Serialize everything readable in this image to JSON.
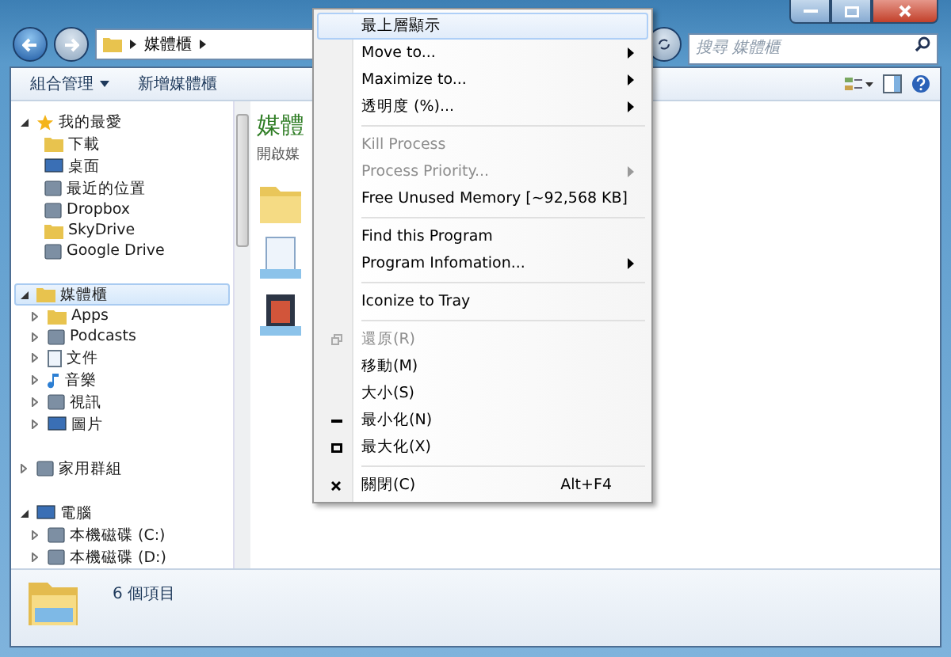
{
  "address_bar": {
    "crumbs": [
      "媒體櫃"
    ]
  },
  "search": {
    "placeholder": "搜尋 媒體櫃"
  },
  "toolbar": {
    "buttons": [
      {
        "label": "組合管理",
        "dropdown": true
      },
      {
        "label": "新增媒體櫃",
        "dropdown": false
      }
    ]
  },
  "sidebar": {
    "groups": [
      {
        "label": "我的最愛",
        "kind": "star",
        "expanded": true,
        "selected": false,
        "children": [
          {
            "label": "下載",
            "kind": "folder"
          },
          {
            "label": "桌面",
            "kind": "screen"
          },
          {
            "label": "最近的位置",
            "kind": "square"
          },
          {
            "label": "Dropbox",
            "kind": "square"
          },
          {
            "label": "SkyDrive",
            "kind": "folder"
          },
          {
            "label": "Google Drive",
            "kind": "square"
          }
        ]
      },
      {
        "label": "媒體櫃",
        "kind": "folder",
        "expanded": true,
        "selected": true,
        "children": [
          {
            "label": "Apps",
            "kind": "folder"
          },
          {
            "label": "Podcasts",
            "kind": "square"
          },
          {
            "label": "文件",
            "kind": "document"
          },
          {
            "label": "音樂",
            "kind": "music"
          },
          {
            "label": "視訊",
            "kind": "square"
          },
          {
            "label": "圖片",
            "kind": "screen"
          }
        ]
      },
      {
        "label": "家用群組",
        "kind": "square",
        "expanded": false,
        "selected": false
      },
      {
        "label": "電腦",
        "kind": "screen",
        "expanded": true,
        "selected": false,
        "children": [
          {
            "label": "本機磁碟 (C:)",
            "kind": "square"
          },
          {
            "label": "本機磁碟 (D:)",
            "kind": "square"
          }
        ]
      }
    ]
  },
  "content": {
    "title": "媒體",
    "subtitle": "開啟媒"
  },
  "status_bar": {
    "text": "6 個項目"
  },
  "context_menu": {
    "items": [
      {
        "kind": "item",
        "label": "最上層顯示",
        "selected": true,
        "disabled": false,
        "submenu": false
      },
      {
        "kind": "item",
        "label": "Move to...",
        "selected": false,
        "disabled": false,
        "submenu": true
      },
      {
        "kind": "item",
        "label": "Maximize to...",
        "selected": false,
        "disabled": false,
        "submenu": true
      },
      {
        "kind": "item",
        "label": "透明度 (%)...",
        "selected": false,
        "disabled": false,
        "submenu": true
      },
      {
        "kind": "separator"
      },
      {
        "kind": "item",
        "label": "Kill Process",
        "selected": false,
        "disabled": true,
        "submenu": false
      },
      {
        "kind": "item",
        "label": "Process Priority...",
        "selected": false,
        "disabled": true,
        "submenu": true
      },
      {
        "kind": "item",
        "label": "Free Unused Memory [~92,568 KB]",
        "selected": false,
        "disabled": false,
        "submenu": false
      },
      {
        "kind": "separator"
      },
      {
        "kind": "item",
        "label": "Find this Program",
        "selected": false,
        "disabled": false,
        "submenu": false
      },
      {
        "kind": "item",
        "label": "Program Infomation...",
        "selected": false,
        "disabled": false,
        "submenu": true
      },
      {
        "kind": "separator"
      },
      {
        "kind": "item",
        "label": "Iconize to Tray",
        "selected": false,
        "disabled": false,
        "submenu": false
      },
      {
        "kind": "separator"
      },
      {
        "kind": "restore",
        "label": "還原(R)",
        "selected": false,
        "disabled": true,
        "submenu": false
      },
      {
        "kind": "item",
        "label": "移動(M)",
        "selected": false,
        "disabled": false,
        "submenu": false
      },
      {
        "kind": "item",
        "label": "大小(S)",
        "selected": false,
        "disabled": false,
        "submenu": false
      },
      {
        "kind": "minimize",
        "label": "最小化(N)",
        "selected": false,
        "disabled": false,
        "submenu": false
      },
      {
        "kind": "maximize",
        "label": "最大化(X)",
        "selected": false,
        "disabled": false,
        "submenu": false
      },
      {
        "kind": "separator"
      },
      {
        "kind": "close",
        "label": "關閉(C)",
        "selected": false,
        "disabled": false,
        "submenu": false,
        "shortcut": "Alt+F4"
      }
    ]
  }
}
